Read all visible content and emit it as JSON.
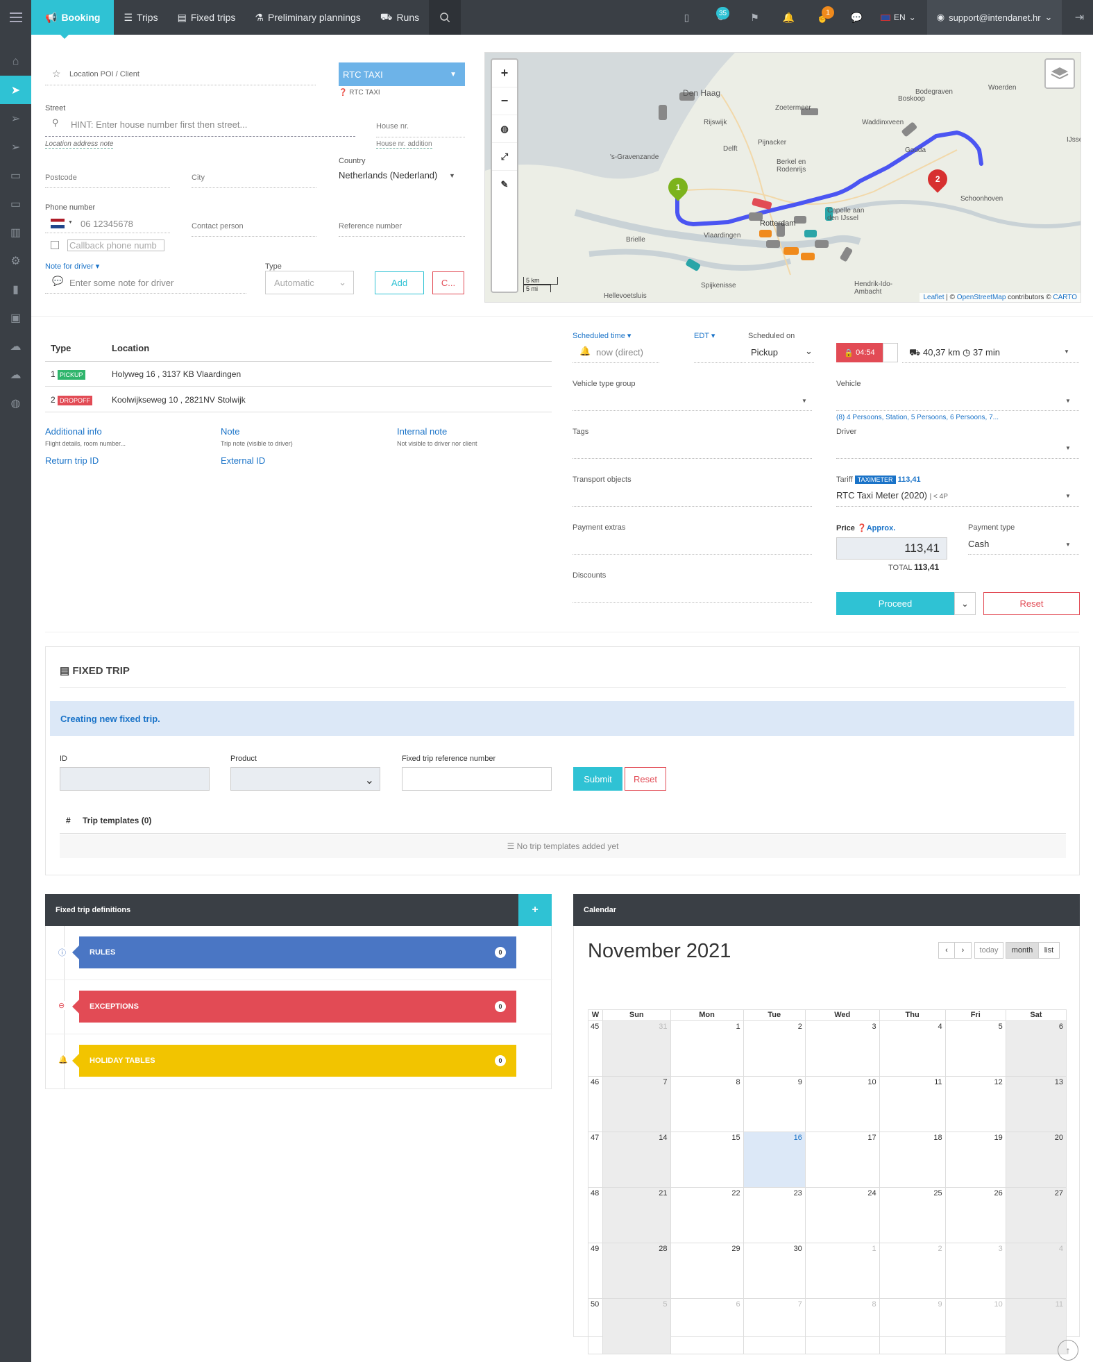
{
  "nav": {
    "tabs": [
      {
        "label": "Booking"
      },
      {
        "label": "Trips"
      },
      {
        "label": "Fixed trips"
      },
      {
        "label": "Preliminary plannings"
      },
      {
        "label": "Runs"
      }
    ],
    "badge_count": "35",
    "notif_count": "1",
    "language": "EN",
    "user": "support@intendanet.hr"
  },
  "location": {
    "poi_placeholder": "Location POI / Client",
    "company": "RTC TAXI",
    "company_sub": "RTC TAXI",
    "street_label": "Street",
    "street_placeholder": "HINT: Enter house number first then street...",
    "address_note": "Location address note",
    "house_nr": "House nr.",
    "house_nr_addition": "House nr. addition",
    "country_label": "Country",
    "country": "Netherlands (Nederland)",
    "postcode": "Postcode",
    "city": "City",
    "phone_label": "Phone number",
    "phone_placeholder": "06 12345678",
    "contact": "Contact person",
    "reference": "Reference number",
    "callback_placeholder": "Callback phone numb",
    "note_driver_label": "Note for driver",
    "note_placeholder": "Enter some note for driver",
    "type_label": "Type",
    "type_value": "Automatic",
    "add_label": "Add",
    "cancel_label": "C..."
  },
  "map": {
    "places": [
      "Den Haag",
      "Rijswijk",
      "Zoetermeer",
      "Bodegraven",
      "Woerden",
      "Boskoop",
      "Waddinxveen",
      "Delft",
      "Pijnacker",
      "'s-Gravenzande",
      "Berkel en Rodenrijs",
      "Gouda",
      "Capelle aan den IJssel",
      "Schoonhoven",
      "Vlaardingen",
      "Brielle",
      "Spijkenisse",
      "Hellevoetsluis",
      "Hendrik-Ido-Ambacht",
      "Rotterdam",
      "IJsselstein"
    ],
    "scale_km": "5 km",
    "scale_mi": "5 mi",
    "marker_start": "1",
    "marker_end": "2",
    "attrib_leaflet": "Leaflet",
    "attrib_osm": "OpenStreetMap",
    "attrib_mid": " | © ",
    "attrib_contrib": " contributors © ",
    "attrib_carto": "CARTO"
  },
  "route_table": {
    "col_type": "Type",
    "col_location": "Location",
    "rows": [
      {
        "num": "1",
        "tag": "PICKUP",
        "location": "Holyweg 16 , 3137 KB Vlaardingen"
      },
      {
        "num": "2",
        "tag": "DROPOFF",
        "location": "Koolwijkseweg 10 , 2821NV Stolwijk"
      }
    ]
  },
  "extras": {
    "additional_info": "Additional info",
    "additional_info_sub": "Flight details, room number...",
    "note": "Note",
    "note_sub": "Trip note (visible to driver)",
    "internal_note": "Internal note",
    "internal_note_sub": "Not visible to driver nor client",
    "return_trip": "Return trip ID",
    "external_id": "External ID"
  },
  "schedule": {
    "scheduled_time": "Scheduled time",
    "time_value": "now (direct)",
    "tz": "EDT",
    "scheduled_on": "Scheduled on",
    "on_value": "Pickup",
    "timer": "04:54",
    "route_info": "40,37 km",
    "route_time": "37 min",
    "vehicle_type_group": "Vehicle type group",
    "vehicle": "Vehicle",
    "vehicle_options": "(8) 4 Persoons, Station, 5 Persoons, 6 Persoons, 7...",
    "tags": "Tags",
    "driver": "Driver",
    "transport_objects": "Transport objects",
    "tariff_label": "Tariff",
    "tariff_badge": "TAXIMETER",
    "tariff_amount": "113,41",
    "tariff_value": "RTC Taxi Meter (2020)",
    "tariff_sub": "| < 4P",
    "payment_extras": "Payment extras",
    "price_label": "Price",
    "approx": "Approx.",
    "price": "113,41",
    "total_label": "TOTAL",
    "total": "113,41",
    "payment_type_label": "Payment type",
    "payment_type": "Cash",
    "discounts": "Discounts",
    "proceed": "Proceed",
    "reset": "Reset"
  },
  "fixed_trip": {
    "title": "FIXED TRIP",
    "info": "Creating new fixed trip.",
    "id_label": "ID",
    "product_label": "Product",
    "ref_label": "Fixed trip reference number",
    "submit": "Submit",
    "reset": "Reset",
    "hash": "#",
    "templates": "Trip templates (0)",
    "no_templates": "No trip templates added yet"
  },
  "definitions": {
    "title": "Fixed trip definitions",
    "add": "+",
    "items": [
      {
        "label": "RULES",
        "count": "0",
        "color": "#4a76c4"
      },
      {
        "label": "EXCEPTIONS",
        "count": "0",
        "color": "#e24b55"
      },
      {
        "label": "HOLIDAY TABLES",
        "count": "0",
        "color": "#f2c400"
      }
    ]
  },
  "calendar": {
    "title": "Calendar",
    "month": "November 2021",
    "today": "today",
    "month_btn": "month",
    "list_btn": "list",
    "headers": [
      "W",
      "Sun",
      "Mon",
      "Tue",
      "Wed",
      "Thu",
      "Fri",
      "Sat"
    ],
    "weeks": [
      [
        "45",
        "31",
        "1",
        "2",
        "3",
        "4",
        "5",
        "6"
      ],
      [
        "46",
        "7",
        "8",
        "9",
        "10",
        "11",
        "12",
        "13"
      ],
      [
        "47",
        "14",
        "15",
        "16",
        "17",
        "18",
        "19",
        "20"
      ],
      [
        "48",
        "21",
        "22",
        "23",
        "24",
        "25",
        "26",
        "27"
      ],
      [
        "49",
        "28",
        "29",
        "30",
        "1",
        "2",
        "3",
        "4"
      ],
      [
        "50",
        "5",
        "6",
        "7",
        "8",
        "9",
        "10",
        "11"
      ]
    ]
  }
}
